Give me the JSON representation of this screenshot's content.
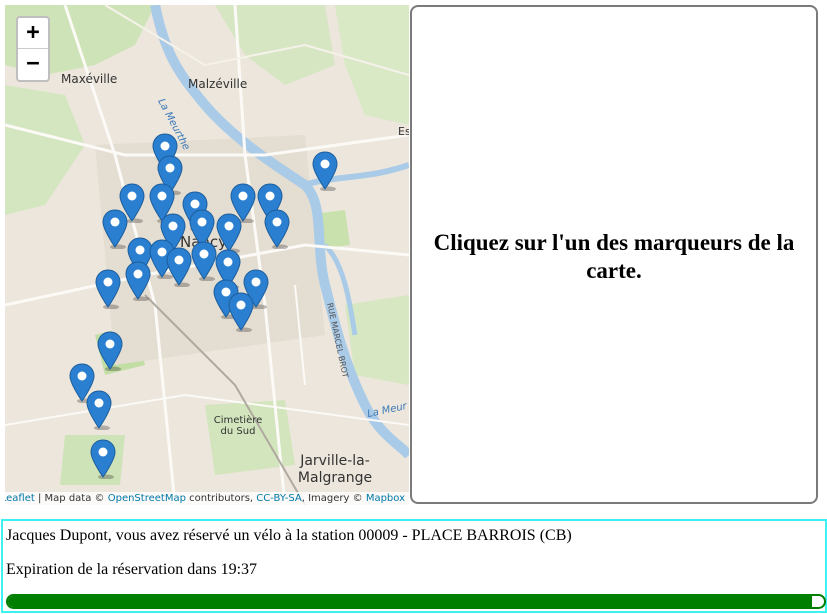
{
  "map": {
    "zoom_in": "+",
    "zoom_out": "−",
    "labels": {
      "maxeville": "Maxéville",
      "malzeville": "Malzéville",
      "la_meurthe": "La Meurthe",
      "nancy": "Nancy",
      "rue_marcel_brot": "RUE MARCEL BROT",
      "cimetiere": "Cimetière du Sud",
      "jarville": "Jarville-la-Malgrange",
      "la_meurthe_south": "La Meur",
      "essey": "Es"
    },
    "attribution": {
      "leaflet": "Leaflet",
      "map_data": "| Map data ©",
      "osm": "OpenStreetMap",
      "contributors": "contributors,",
      "license": "CC-BY-SA",
      "imagery": ", Imagery ©",
      "mapbox": "Mapbox"
    },
    "marker_color": "#2a7fd0",
    "marker_count": 31
  },
  "panel": {
    "message": "Cliquez sur l'un des marqueurs de la carte."
  },
  "reservation": {
    "message": "Jacques Dupont, vous avez réservé un vélo à la station 00009 - PLACE BARROIS (CB)",
    "expiration": "Expiration de la réservation dans 19:37",
    "progress_fraction": 0.985,
    "bar_color": "#007f00",
    "border_color": "#3ff0f0"
  }
}
